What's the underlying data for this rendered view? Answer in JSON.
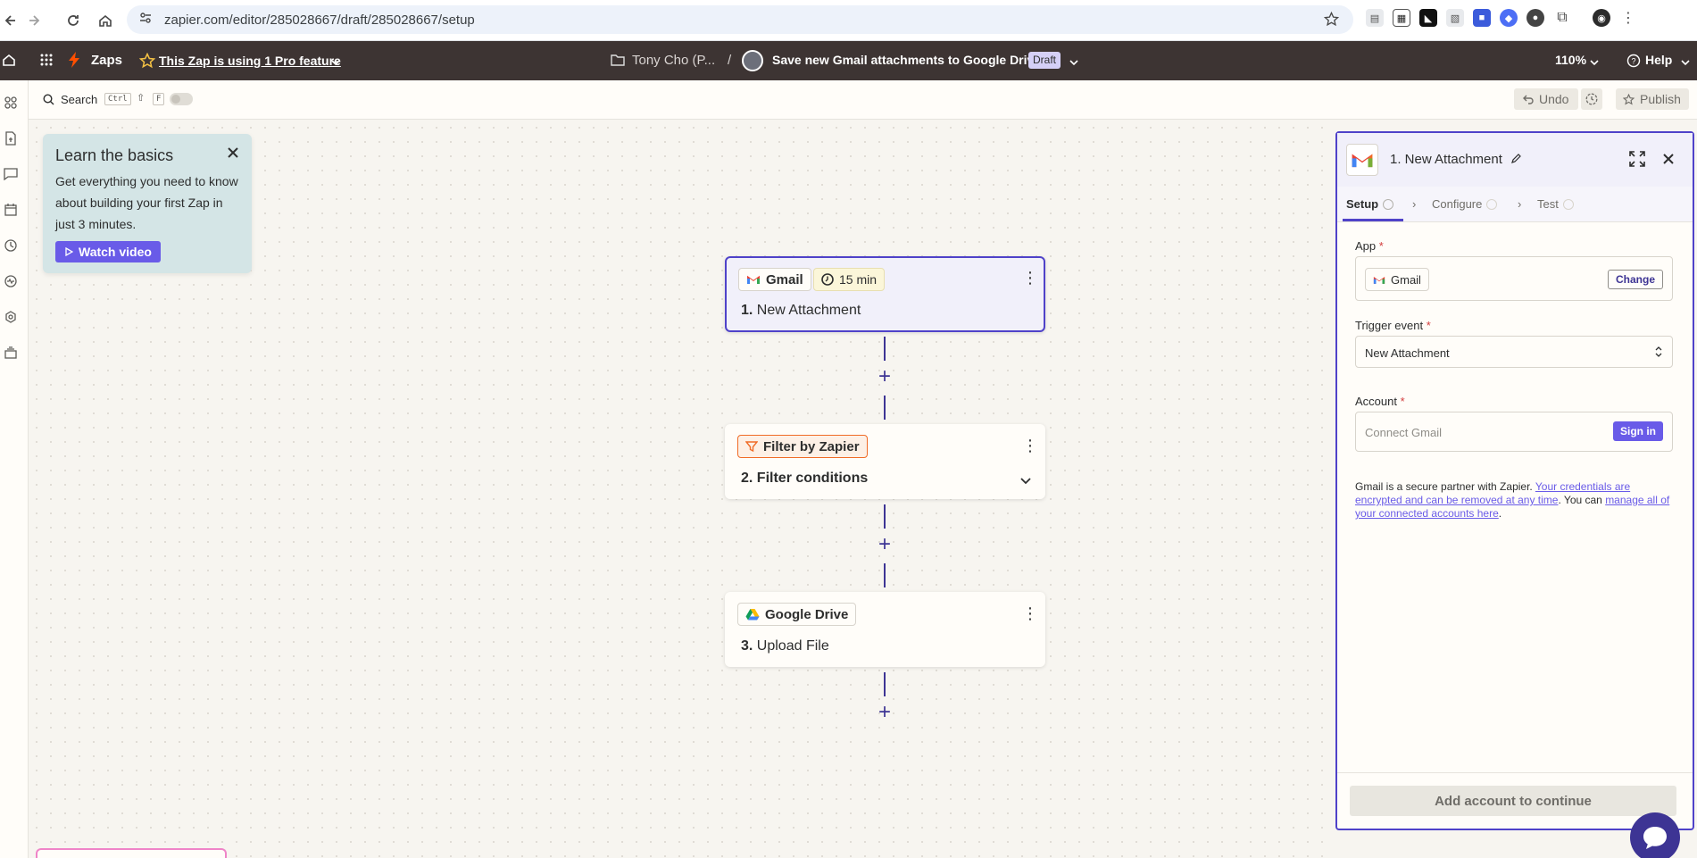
{
  "browser": {
    "url": "zapier.com/editor/285028667/draft/285028667/setup"
  },
  "header": {
    "zaps_label": "Zaps",
    "pro_feature_label": "This Zap is using 1 Pro feature",
    "folder_label": "Tony Cho (P...",
    "separator": "/",
    "zap_title": "Save new Gmail attachments to Google Drive",
    "draft_badge": "Draft",
    "zoom": "110%",
    "help_label": "Help"
  },
  "toolbar": {
    "search_label": "Search",
    "shortcut_ctrl": "Ctrl",
    "shortcut_f": "F",
    "undo_label": "Undo",
    "publish_label": "Publish"
  },
  "learn": {
    "title": "Learn the basics",
    "body": "Get everything you need to know about building your first Zap in just 3 minutes.",
    "watch_label": "Watch video"
  },
  "steps": [
    {
      "app": "Gmail",
      "interval": "15 min",
      "number": "1.",
      "name": "New Attachment"
    },
    {
      "app": "Filter by Zapier",
      "number": "2.",
      "name": "Filter conditions"
    },
    {
      "app": "Google Drive",
      "number": "3.",
      "name": "Upload File"
    }
  ],
  "panel": {
    "title": "1. New Attachment",
    "tabs": [
      {
        "label": "Setup"
      },
      {
        "label": "Configure"
      },
      {
        "label": "Test"
      }
    ],
    "app_label": "App",
    "app_value": "Gmail",
    "change_label": "Change",
    "trigger_label": "Trigger event",
    "trigger_value": "New Attachment",
    "account_label": "Account",
    "account_placeholder": "Connect Gmail",
    "signin_label": "Sign in",
    "info_prefix": "Gmail is a secure partner with Zapier. ",
    "info_link1": "Your credentials are encrypted and can be removed at any time",
    "info_mid": ". You can ",
    "info_link2": "manage all of your connected accounts here",
    "info_suffix": ".",
    "add_account_label": "Add account to continue"
  },
  "colors": {
    "accent": "#695be8",
    "header_bg": "#3d3433",
    "connector": "#3d3494",
    "selected_border": "#4f42c9",
    "filter_orange": "#f06b26"
  }
}
